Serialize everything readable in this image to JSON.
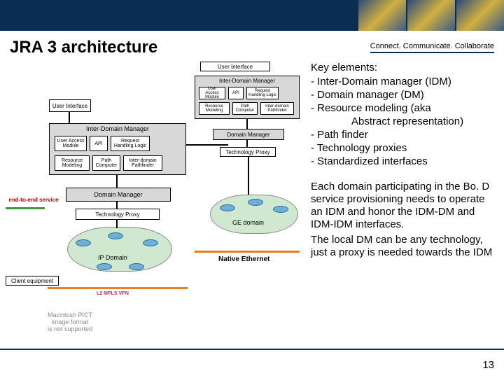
{
  "header": {
    "title": "JRA 3 architecture",
    "tagline": "Connect. Communicate. Collaborate"
  },
  "text": {
    "key_heading": "Key elements:",
    "items": [
      "- Inter-Domain manager (IDM)",
      "- Domain manager (DM)",
      "-  Resource modeling (aka",
      "-  Path finder",
      "-  Technology proxies",
      "-  Standardized interfaces"
    ],
    "item_indent": "Abstract representation)",
    "para1": "Each domain participating in the Bo. D service provisioning needs to operate an IDM and honor the IDM-DM and IDM-IDM interfaces.",
    "para2": "The local DM can be any technology, just a proxy is needed towards the IDM"
  },
  "diagram": {
    "ui_small": "User Interface",
    "idm_small": "Inter-Domain Manager",
    "ua_mod": "User Access Module",
    "api": "API",
    "req_logic": "Request Handling Logic",
    "res_mod": "Resource Modeling",
    "pathc": "Path Computer",
    "idp": "Inter-domain Pathfinder",
    "ui": "User Interface",
    "idm": "Inter-Domain Manager",
    "dm_small": "Domain Manager",
    "tp_small": "Technology Proxy",
    "dm": "Domain Manager",
    "tp": "Technology Proxy",
    "e2e": "end-to-end service",
    "client": "Client equipment",
    "ip_domain": "IP Domain",
    "ge_domain": "GE domain",
    "l2": "L2 MPLS VPN",
    "native_eth": "Native Ethernet",
    "pict_note": "Macintosh PICT\nimage format\nis not supported"
  },
  "page_number": "13"
}
